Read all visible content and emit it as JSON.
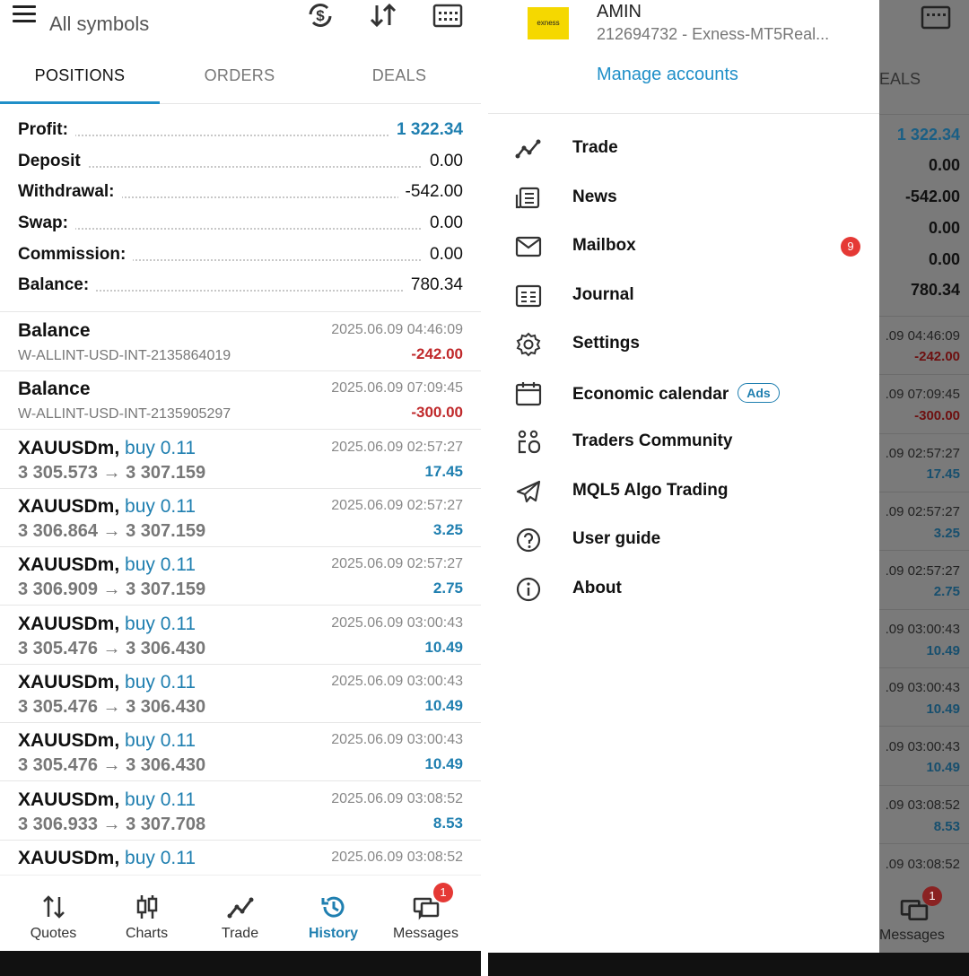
{
  "left": {
    "header": {
      "title": "All symbols"
    },
    "tabs": [
      "POSITIONS",
      "ORDERS",
      "DEALS"
    ],
    "summary": [
      {
        "label": "Profit:",
        "value": "1 322.34"
      },
      {
        "label": "Deposit",
        "value": "0.00"
      },
      {
        "label": "Withdrawal:",
        "value": "-542.00"
      },
      {
        "label": "Swap:",
        "value": "0.00"
      },
      {
        "label": "Commission:",
        "value": "0.00"
      },
      {
        "label": "Balance:",
        "value": "780.34"
      }
    ],
    "deals": [
      {
        "symbol": "Balance",
        "side": "",
        "sub": "W-ALLINT-USD-INT-2135864019",
        "time": "2025.06.09 04:46:09",
        "amount": "-242.00"
      },
      {
        "symbol": "Balance",
        "side": "",
        "sub": "W-ALLINT-USD-INT-2135905297",
        "time": "2025.06.09 07:09:45",
        "amount": "-300.00"
      },
      {
        "symbol": "XAUUSDm,",
        "side": "buy 0.11",
        "sub": "3 305.573 → 3 307.159",
        "time": "2025.06.09 02:57:27",
        "amount": "17.45"
      },
      {
        "symbol": "XAUUSDm,",
        "side": "buy 0.11",
        "sub": "3 306.864 → 3 307.159",
        "time": "2025.06.09 02:57:27",
        "amount": "3.25"
      },
      {
        "symbol": "XAUUSDm,",
        "side": "buy 0.11",
        "sub": "3 306.909 → 3 307.159",
        "time": "2025.06.09 02:57:27",
        "amount": "2.75"
      },
      {
        "symbol": "XAUUSDm,",
        "side": "buy 0.11",
        "sub": "3 305.476 → 3 306.430",
        "time": "2025.06.09 03:00:43",
        "amount": "10.49"
      },
      {
        "symbol": "XAUUSDm,",
        "side": "buy 0.11",
        "sub": "3 305.476 → 3 306.430",
        "time": "2025.06.09 03:00:43",
        "amount": "10.49"
      },
      {
        "symbol": "XAUUSDm,",
        "side": "buy 0.11",
        "sub": "3 305.476 → 3 306.430",
        "time": "2025.06.09 03:00:43",
        "amount": "10.49"
      },
      {
        "symbol": "XAUUSDm,",
        "side": "buy 0.11",
        "sub": "3 306.933 → 3 307.708",
        "time": "2025.06.09 03:08:52",
        "amount": "8.53"
      },
      {
        "symbol": "XAUUSDm,",
        "side": "buy 0.11",
        "sub": "",
        "time": "2025.06.09 03:08:52",
        "amount": ""
      }
    ],
    "bottom_nav": [
      {
        "label": "Quotes",
        "icon": "quotes-icon"
      },
      {
        "label": "Charts",
        "icon": "charts-icon"
      },
      {
        "label": "Trade",
        "icon": "trade-icon"
      },
      {
        "label": "History",
        "icon": "history-icon",
        "active": true
      },
      {
        "label": "Messages",
        "icon": "messages-icon",
        "badge": "1"
      }
    ]
  },
  "right": {
    "account": {
      "logo_text": "exness",
      "name": "AMIN",
      "number": "212694732 - Exness-MT5Real...",
      "manage_label": "Manage accounts"
    },
    "menu": [
      {
        "label": "Trade",
        "icon": "trade-icon"
      },
      {
        "label": "News",
        "icon": "news-icon"
      },
      {
        "label": "Mailbox",
        "icon": "mailbox-icon",
        "badge": "9"
      },
      {
        "label": "Journal",
        "icon": "journal-icon"
      },
      {
        "label": "Settings",
        "icon": "settings-icon"
      },
      {
        "label": "Economic calendar",
        "icon": "calendar-icon",
        "tag": "Ads"
      },
      {
        "label": "Traders Community",
        "icon": "community-icon"
      },
      {
        "label": "MQL5 Algo Trading",
        "icon": "telegram-icon"
      },
      {
        "label": "User guide",
        "icon": "help-icon"
      },
      {
        "label": "About",
        "icon": "info-icon"
      }
    ],
    "background": {
      "tab_fragment": "EALS",
      "values": [
        "1 322.34",
        "0.00",
        "-542.00",
        "0.00",
        "0.00",
        "780.34"
      ],
      "rows": [
        {
          "time": ".09 04:46:09",
          "amount": "-242.00"
        },
        {
          "time": ".09 07:09:45",
          "amount": "-300.00"
        },
        {
          "time": ".09 02:57:27",
          "amount": "17.45"
        },
        {
          "time": ".09 02:57:27",
          "amount": "3.25"
        },
        {
          "time": ".09 02:57:27",
          "amount": "2.75"
        },
        {
          "time": ".09 03:00:43",
          "amount": "10.49"
        },
        {
          "time": ".09 03:00:43",
          "amount": "10.49"
        },
        {
          "time": ".09 03:00:43",
          "amount": "10.49"
        },
        {
          "time": ".09 03:08:52",
          "amount": "8.53"
        },
        {
          "time": ".09 03:08:52",
          "amount": ""
        }
      ],
      "messages_label": "Messages",
      "messages_badge": "1"
    }
  },
  "colors": {
    "accent": "#1f7fb0",
    "negative": "#c0292b",
    "badge": "#e53935",
    "logo": "#f5d800"
  }
}
